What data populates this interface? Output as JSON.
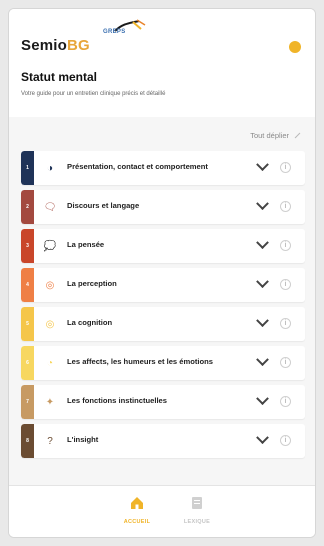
{
  "app": {
    "name_prefix": "Semio",
    "name_suffix": "BG",
    "brand_small": "GREPS"
  },
  "page": {
    "title": "Statut mental",
    "subtitle": "Votre guide pour un entretien clinique précis et détaillé"
  },
  "toolbar": {
    "expand_all": "Tout déplier"
  },
  "sections": [
    {
      "number": "1",
      "label": "Présentation, contact et comportement",
      "color": "#1f3358",
      "icon": "face-icon",
      "icon_glyph": "◑"
    },
    {
      "number": "2",
      "label": "Discours et langage",
      "color": "#a3493f",
      "icon": "speech-bubble-icon",
      "icon_glyph": "🗨"
    },
    {
      "number": "3",
      "label": "La pensée",
      "color": "#c9462a",
      "icon": "thought-bubble-icon",
      "icon_glyph": "💭"
    },
    {
      "number": "4",
      "label": "La perception",
      "color": "#ef7f45",
      "icon": "perception-icon",
      "icon_glyph": "◎"
    },
    {
      "number": "5",
      "label": "La cognition",
      "color": "#f5c64a",
      "icon": "brain-icon",
      "icon_glyph": "◎"
    },
    {
      "number": "6",
      "label": "Les affects, les humeurs et les émotions",
      "color": "#f7d760",
      "icon": "emotion-icon",
      "icon_glyph": "◔"
    },
    {
      "number": "7",
      "label": "Les fonctions instinctuelles",
      "color": "#c79a63",
      "icon": "instinct-icon",
      "icon_glyph": "✦"
    },
    {
      "number": "8",
      "label": "L'insight",
      "color": "#6b4c32",
      "icon": "insight-icon",
      "icon_glyph": "?"
    }
  ],
  "tabs": [
    {
      "label": "ACCUEIL",
      "icon": "home-icon",
      "active": true
    },
    {
      "label": "LEXIQUE",
      "icon": "book-icon",
      "active": false
    }
  ],
  "colors": {
    "accent": "#f0b429"
  }
}
